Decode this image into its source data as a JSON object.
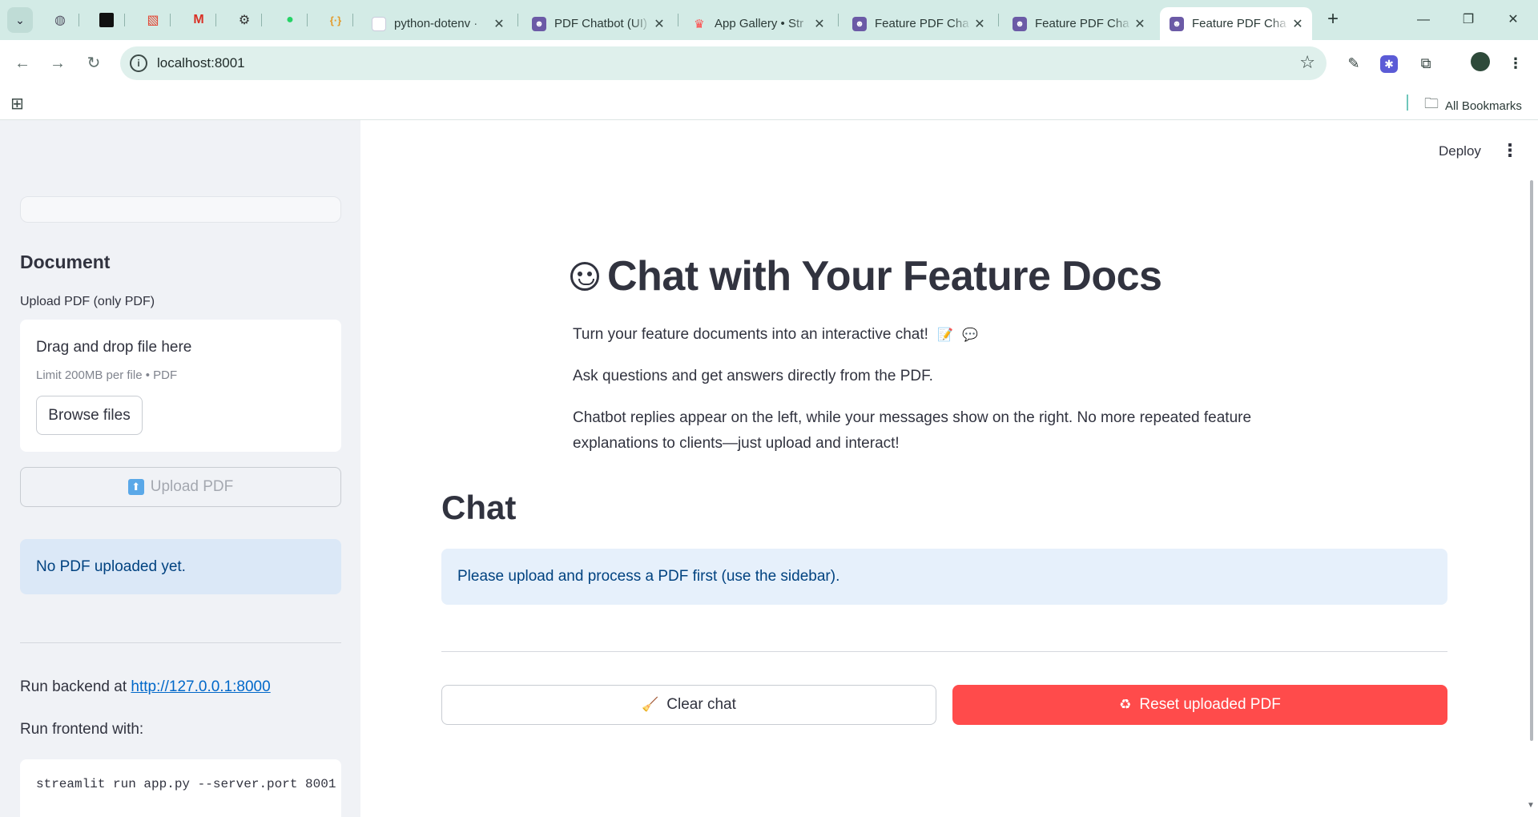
{
  "browser": {
    "tabs": [
      {
        "title": "python-dotenv ·",
        "icon": "file-icon"
      },
      {
        "title": "PDF Chatbot (UI)",
        "icon": "robot-icon"
      },
      {
        "title": "App Gallery • Str",
        "icon": "streamlit-crown-icon"
      },
      {
        "title": "Feature PDF Cha",
        "icon": "robot-icon"
      },
      {
        "title": "Feature PDF Cha",
        "icon": "robot-icon"
      },
      {
        "title": "Feature PDF Cha",
        "icon": "robot-icon",
        "active": true
      }
    ],
    "url": "localhost:8001",
    "bookmarks_label": "All Bookmarks"
  },
  "sidebar": {
    "heading": "Document",
    "upload_label": "Upload PDF (only PDF)",
    "dropzone_title": "Drag and drop file here",
    "dropzone_limit": "Limit 200MB per file • PDF",
    "browse_label": "Browse files",
    "upload_button_label": "Upload PDF",
    "status_text": "No PDF uploaded yet.",
    "backend_prefix": "Run backend at ",
    "backend_url": "http://127.0.0.1:8000",
    "frontend_label": "Run frontend with:",
    "command": "streamlit run app.py --server.port 8001"
  },
  "main": {
    "deploy_label": "Deploy",
    "title": "Chat with Your Feature Docs",
    "intro1": "Turn your feature documents into an interactive chat!",
    "intro2": "Ask questions and get answers directly from the PDF.",
    "intro3": "Chatbot replies appear on the left, while your messages show on the right. No more repeated feature explanations to clients—just upload and interact!",
    "chat_heading": "Chat",
    "info_message": "Please upload and process a PDF first (use the sidebar).",
    "clear_label": "Clear chat",
    "reset_label": "Reset uploaded PDF"
  },
  "colors": {
    "primary": "#ff4b4b",
    "info_bg": "#e6f0fb",
    "info_text": "#004280",
    "sidebar_bg": "#f0f2f6",
    "browser_frame": "#d3ebe6"
  }
}
